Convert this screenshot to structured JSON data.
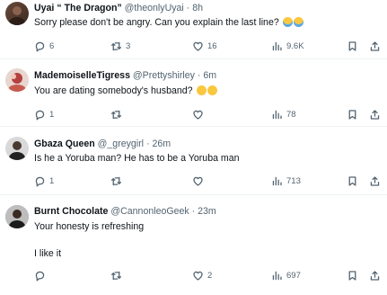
{
  "tweets": [
    {
      "name": "Uyai “ The Dragon”",
      "handle": "@theonlyUyai",
      "time": "· 8h",
      "text": "Sorry please don't be angry. Can you explain the last line?",
      "emojis": [
        "loudly-crying-face",
        "loudly-crying-face"
      ],
      "replies": "6",
      "retweets": "3",
      "likes": "16",
      "views": "9.6K"
    },
    {
      "name": "MademoiselleTigress",
      "handle": "@Prettyshirley",
      "time": "· 6m",
      "text": "You are dating somebody's husband?",
      "emojis": [
        "smirking-face",
        "smirking-face"
      ],
      "replies": "1",
      "retweets": "",
      "likes": "",
      "views": "78"
    },
    {
      "name": "Gbaza Queen",
      "handle": "@_greygirl",
      "time": "· 26m",
      "text": "Is he a Yoruba man? He has to be a Yoruba man",
      "emojis": [],
      "replies": "1",
      "retweets": "",
      "likes": "",
      "views": "713"
    },
    {
      "name": "Burnt Chocolate",
      "handle": "@CannonleoGeek",
      "time": "· 23m",
      "text": "Your honesty is refreshing",
      "text2": "I like it",
      "emojis": [],
      "replies": "",
      "retweets": "",
      "likes": "2",
      "views": "697"
    }
  ],
  "colors": {
    "text": "#0f1419",
    "muted": "#536471",
    "divider": "#eff3f4",
    "emoji_yellow": "#f9c740",
    "emoji_tear": "#5aa9e6"
  },
  "icons": [
    "reply-icon",
    "retweet-icon",
    "like-icon",
    "views-icon",
    "bookmark-icon",
    "share-icon"
  ]
}
